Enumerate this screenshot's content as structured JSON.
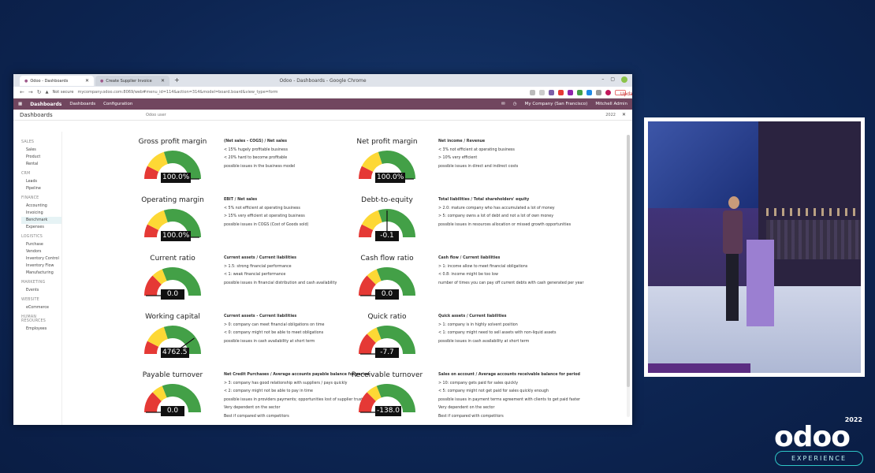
{
  "browser": {
    "window_title": "Odoo - Dashboards - Google Chrome",
    "tabs": [
      {
        "label": "Odoo - Dashboards",
        "active": true
      },
      {
        "label": "Create Supplier Invoice",
        "active": false
      }
    ],
    "url_prefix": "Not secure",
    "url": "mycompany.odoo.com:8069/web#menu_id=114&action=314&model=board.board&view_type=form",
    "update_label": "Update"
  },
  "odoo": {
    "app_name": "Dashboards",
    "menu": [
      "Dashboards",
      "Configuration"
    ],
    "company": "My Company (San Francisco)",
    "user": "Mitchell Admin",
    "breadcrumb": "Dashboards",
    "search_placeholder": "Odoo user",
    "year": "2022"
  },
  "sidebar": [
    {
      "section": "SALES",
      "items": [
        "Sales",
        "Product",
        "Rental"
      ]
    },
    {
      "section": "CRM",
      "items": [
        "Leads",
        "Pipeline"
      ]
    },
    {
      "section": "FINANCE",
      "items": [
        "Accounting",
        "Invoicing",
        "Benchmark",
        "Expenses"
      ]
    },
    {
      "section": "LOGISTICS",
      "items": [
        "Purchase",
        "Vendors",
        "Inventory Control",
        "Inventory Flow",
        "Manufacturing"
      ]
    },
    {
      "section": "MARKETING",
      "items": [
        "Events"
      ]
    },
    {
      "section": "WEBSITE",
      "items": [
        "eCommerce"
      ]
    },
    {
      "section": "HUMAN RESOURCES",
      "items": [
        "Employees"
      ]
    }
  ],
  "active_sidebar_item": "Benchmark",
  "kpis": [
    {
      "name": "Gross profit margin",
      "value": "100.0%",
      "gauge": 1.0,
      "formula": "(Net sales - COGS) / Net sales",
      "lines": [
        "< 15% hugely profitable business",
        "< 20% hard to become profitable",
        "possible issues in the business model"
      ]
    },
    {
      "name": "Net profit margin",
      "value": "100.0%",
      "gauge": 1.0,
      "formula": "Net income / Revenue",
      "lines": [
        "< 3% not efficient at operating business",
        "> 10% very efficient",
        "possible issues in direct and indirect costs"
      ]
    },
    {
      "name": "Operating margin",
      "value": "100.0%",
      "gauge": 1.0,
      "formula": "EBIT / Net sales",
      "lines": [
        "< 5% not efficient at operating business",
        "> 15% very efficient at operating business",
        "possible issues in COGS (Cost of Goods sold)"
      ]
    },
    {
      "name": "Debt-to-equity",
      "value": "-0.1",
      "gauge": 0.5,
      "formula": "Total liabilities / Total shareholders' equity",
      "lines": [
        "> 2.0: mature company who has accumulated a lot of money",
        "> 5: company owns a lot of debt and not a lot of own money",
        "possible issues in resources allocation or missed growth opportunities"
      ]
    },
    {
      "name": "Current ratio",
      "value": "0.0",
      "gauge": 0.0,
      "formula": "Current assets / Current liabilities",
      "lines": [
        "> 1.5: strong financial performance",
        "< 1: weak financial performance",
        "possible issues in financial distribution and cash availability"
      ]
    },
    {
      "name": "Cash flow ratio",
      "value": "0.0",
      "gauge": 0.0,
      "formula": "Cash flow / Current liabilities",
      "lines": [
        "> 1: income allow to meet financial obligations",
        "< 0.8: income might be too low",
        "number of times you can pay off current debts with cash generated per year"
      ]
    },
    {
      "name": "Working capital",
      "value": "4762.5",
      "gauge": 0.8,
      "formula": "Current assets - Current liabilities",
      "lines": [
        "> 0: company can meet financial obligations on time",
        "< 0: company might not be able to meet obligations",
        "possible issues in cash availability at short term"
      ]
    },
    {
      "name": "Quick ratio",
      "value": "-7.7",
      "gauge": 0.0,
      "formula": "Quick assets / Current liabilities",
      "lines": [
        "> 1: company is in highly solvent position",
        "< 1: company might need to sell assets with non-liquid assets",
        "possible issues in cash availability at short term"
      ]
    },
    {
      "name": "Payable turnover",
      "value": "0.0",
      "gauge": 0.0,
      "formula": "Net Credit Purchases / Average accounts payable balance for period",
      "lines": [
        "> 3: company has good relationship with suppliers / pays quickly",
        "< 2: company might not be able to pay in time",
        "possible issues in providers payments; opportunities lost of supplier trust",
        "Very dependent on the sector",
        "Best if compared with competitors"
      ]
    },
    {
      "name": "Receivable turnover",
      "value": "-138.0",
      "gauge": 0.0,
      "formula": "Sales on account / Average accounts receivable balance for period",
      "lines": [
        "> 10: company gets paid for sales quickly",
        "< 5: company might not get paid for sales quickly enough",
        "possible issues in payment terms agreement with clients to get paid faster",
        "Very dependent on the sector",
        "Best if compared with competitors"
      ]
    }
  ],
  "colors": {
    "red": "#e53935",
    "yellow": "#fdd835",
    "green": "#43a047",
    "odoo_purple": "#71465f"
  },
  "branding": {
    "year": "2022",
    "logo": "odoo",
    "tagline": "EXPERIENCE"
  }
}
